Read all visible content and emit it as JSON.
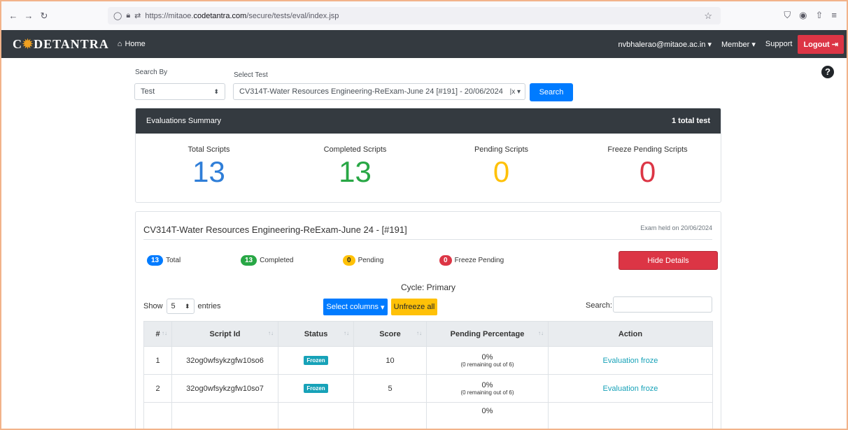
{
  "browser": {
    "url_prefix": "https://mitaoe.",
    "url_domain": "codetantra.com",
    "url_path": "/secure/tests/eval/index.jsp"
  },
  "navbar": {
    "brand_pre": "C",
    "brand_post": "DETANTRA",
    "home": "Home",
    "user_email": "nvbhalerao@mitaoe.ac.in",
    "member": "Member",
    "support": "Support",
    "logout": "Logout"
  },
  "search": {
    "search_by_label": "Search By",
    "search_by_value": "Test",
    "select_test_label": "Select Test",
    "select_test_value": "CV314T-Water Resources Engineering-ReExam-June 24 [#191] - 20/06/2024",
    "search_button": "Search"
  },
  "summary": {
    "title": "Evaluations Summary",
    "total_tests": "1 total test",
    "stats": [
      {
        "label": "Total Scripts",
        "value": "13",
        "color": "#2f7ed8"
      },
      {
        "label": "Completed Scripts",
        "value": "13",
        "color": "#28a745"
      },
      {
        "label": "Pending Scripts",
        "value": "0",
        "color": "#ffc107"
      },
      {
        "label": "Freeze Pending Scripts",
        "value": "0",
        "color": "#dc3545"
      }
    ]
  },
  "details": {
    "test_title": "CV314T-Water Resources Engineering-ReExam-June 24 - [#191]",
    "exam_held": "Exam held on 20/06/2024",
    "counts": {
      "total": {
        "count": "13",
        "label": "Total"
      },
      "completed": {
        "count": "13",
        "label": "Completed"
      },
      "pending": {
        "count": "0",
        "label": "Pending"
      },
      "freeze_pending": {
        "count": "0",
        "label": "Freeze Pending"
      }
    },
    "hide_details": "Hide Details",
    "cycle": "Cycle: Primary",
    "show": "Show",
    "entries_value": "5",
    "entries": "entries",
    "select_columns": "Select columns",
    "unfreeze_all": "Unfreeze all",
    "search_label": "Search:",
    "columns": [
      "#",
      "Script Id",
      "Status",
      "Score",
      "Pending Percentage",
      "Action"
    ],
    "rows": [
      {
        "num": "1",
        "script_id": "32og0wfsykzgfw10so6",
        "status": "Frozen",
        "score": "10",
        "pct": "0%",
        "pct_sub": "(0 remaining out of 6)",
        "action": "Evaluation froze"
      },
      {
        "num": "2",
        "script_id": "32og0wfsykzgfw10so7",
        "status": "Frozen",
        "score": "5",
        "pct": "0%",
        "pct_sub": "(0 remaining out of 6)",
        "action": "Evaluation froze"
      },
      {
        "num": "",
        "script_id": "",
        "status": "",
        "score": "",
        "pct": "0%",
        "pct_sub": "",
        "action": ""
      }
    ]
  }
}
